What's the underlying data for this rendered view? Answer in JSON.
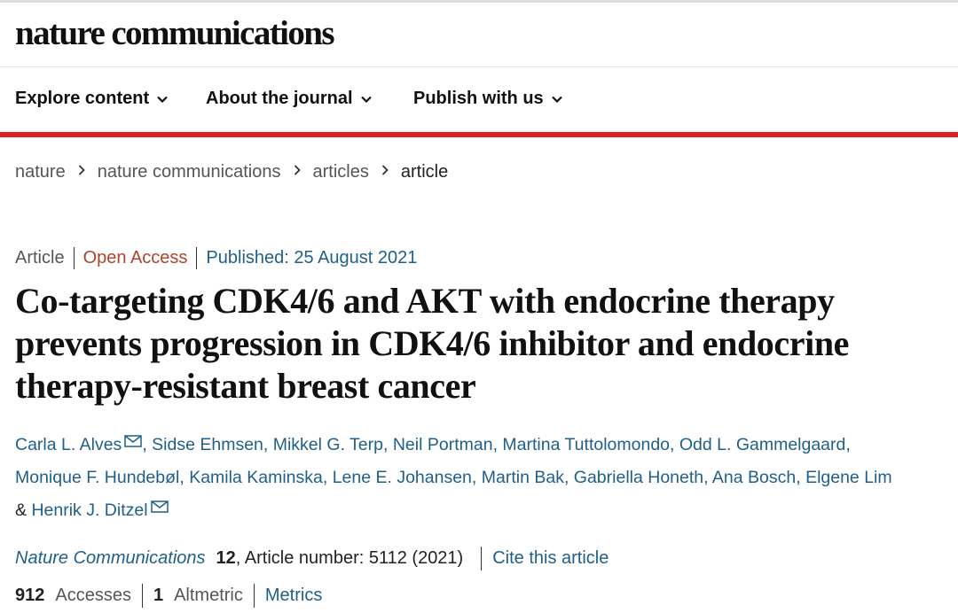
{
  "header": {
    "logo": "nature communications"
  },
  "nav": {
    "items": [
      {
        "label": "Explore content"
      },
      {
        "label": "About the journal"
      },
      {
        "label": "Publish with us"
      }
    ]
  },
  "breadcrumb": [
    "nature",
    "nature communications",
    "articles",
    "article"
  ],
  "meta": {
    "type": "Article",
    "access": "Open Access",
    "published": "Published: 25 August 2021"
  },
  "title": "Co-targeting CDK4/6 and AKT with endocrine therapy prevents progression in CDK4/6 inhibitor and endocrine therapy-resistant breast cancer",
  "authors": {
    "list": [
      "Carla L. Alves",
      "Sidse Ehmsen",
      "Mikkel G. Terp",
      "Neil Portman",
      "Martina Tuttolomondo",
      "Odd L. Gammelgaard",
      "Monique F. Hundebøl",
      "Kamila Kaminska",
      "Lene E. Johansen",
      "Martin Bak",
      "Gabriella Honeth",
      "Ana Bosch",
      "Elgene Lim",
      "Henrik J. Ditzel"
    ],
    "separator": ",",
    "and": "&"
  },
  "citation": {
    "journal": "Nature Communications",
    "volume": "12",
    "article_number": ", Article number: 5112 (2021)",
    "cite_label": "Cite this article"
  },
  "metrics": {
    "accesses_value": "912",
    "accesses_label": "Accesses",
    "altmetric_value": "1",
    "altmetric_label": "Altmetric",
    "metrics_link": "Metrics"
  },
  "colors": {
    "accent_red": "#e01f26",
    "link_blue": "#1f5f8b",
    "open_access": "#b0432a"
  }
}
